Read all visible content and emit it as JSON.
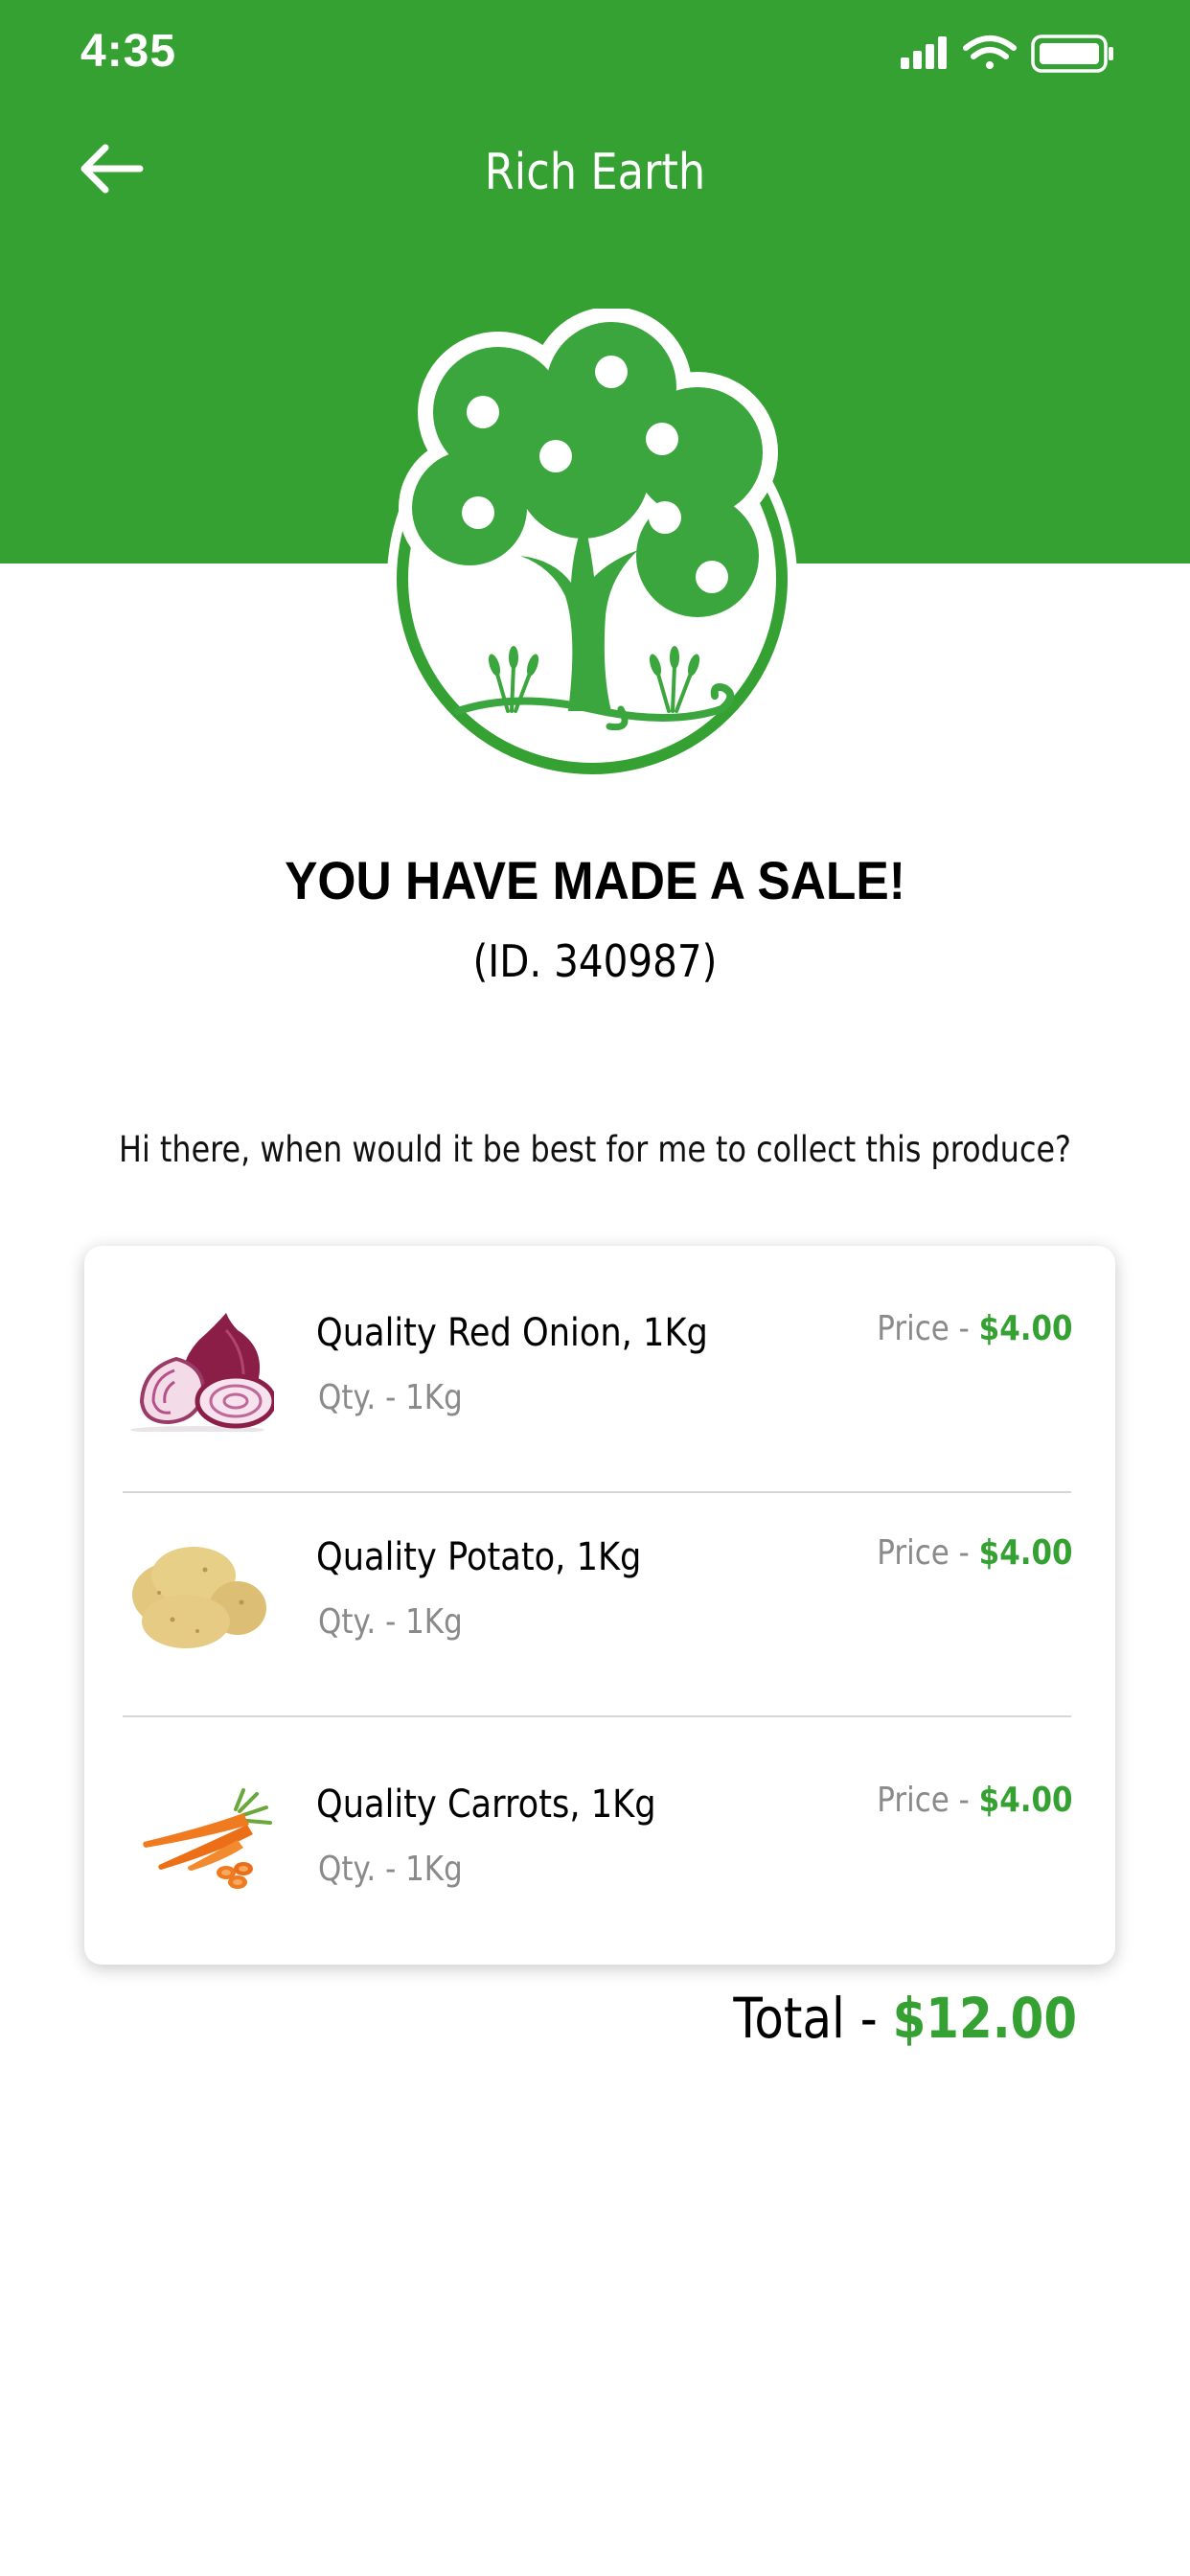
{
  "status_bar": {
    "time": "4:35"
  },
  "nav": {
    "title": "Rich Earth"
  },
  "sale": {
    "title": "YOU HAVE MADE A SALE!",
    "id_text": "(ID. 340987)",
    "message": "Hi there, when would it be best for me to collect this produce?"
  },
  "items": [
    {
      "name": "Quality Red Onion, 1Kg",
      "qty": "Qty. - 1Kg",
      "price_label": "Price - ",
      "price_value": "$4.00"
    },
    {
      "name": "Quality Potato, 1Kg",
      "qty": "Qty. - 1Kg",
      "price_label": "Price - ",
      "price_value": "$4.00"
    },
    {
      "name": "Quality Carrots, 1Kg",
      "qty": "Qty. - 1Kg",
      "price_label": "Price - ",
      "price_value": "$4.00"
    }
  ],
  "total": {
    "label": "Total - ",
    "value": "$12.00"
  },
  "colors": {
    "brand_green": "#35a132",
    "muted_text": "#8a8a8a",
    "divider": "#d6d6d6"
  },
  "icons": [
    "back-arrow-icon",
    "signal-icon",
    "wifi-icon",
    "battery-icon",
    "tree-logo-icon",
    "red-onion-image",
    "potato-image",
    "carrot-image"
  ]
}
